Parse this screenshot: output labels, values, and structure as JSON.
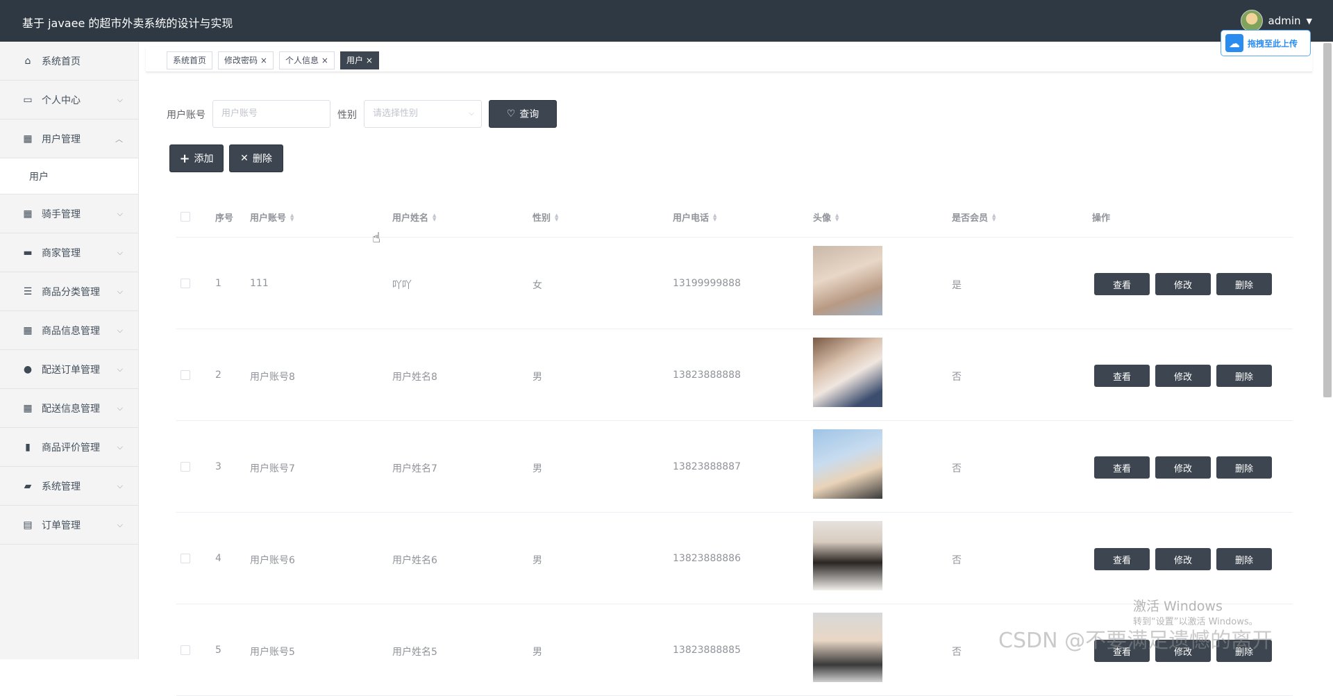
{
  "header": {
    "title": "基于 javaee 的超市外卖系统的设计与实现",
    "user_name": "admin",
    "user_caret": "▼"
  },
  "upload": {
    "label": "拖拽至此上传"
  },
  "sidebar": {
    "items": [
      {
        "label": "系统首页",
        "icon": "home-icon",
        "arrow": ""
      },
      {
        "label": "个人中心",
        "icon": "card-icon",
        "arrow": "⌵"
      },
      {
        "label": "用户管理",
        "icon": "grid-icon",
        "arrow": "︿"
      },
      {
        "label": "骑手管理",
        "icon": "grid-icon",
        "arrow": "⌵"
      },
      {
        "label": "商家管理",
        "icon": "briefcase-icon",
        "arrow": "⌵"
      },
      {
        "label": "商品分类管理",
        "icon": "list-icon",
        "arrow": "⌵"
      },
      {
        "label": "商品信息管理",
        "icon": "grid-icon",
        "arrow": "⌵"
      },
      {
        "label": "配送订单管理",
        "icon": "pin-icon",
        "arrow": "⌵"
      },
      {
        "label": "配送信息管理",
        "icon": "grid-icon",
        "arrow": "⌵"
      },
      {
        "label": "商品评价管理",
        "icon": "book-icon",
        "arrow": "⌵"
      },
      {
        "label": "系统管理",
        "icon": "ticket-icon",
        "arrow": "⌵"
      },
      {
        "label": "订单管理",
        "icon": "clipboard-icon",
        "arrow": "⌵"
      }
    ],
    "sub_item": "用户"
  },
  "tags": [
    {
      "label": "系统首页"
    },
    {
      "label": "修改密码 ×"
    },
    {
      "label": "个人信息 ×"
    },
    {
      "label": "用户 ×"
    }
  ],
  "search": {
    "account_label": "用户账号",
    "account_placeholder": "用户账号",
    "gender_label": "性别",
    "gender_placeholder": "请选择性别",
    "query_label": "查询"
  },
  "actions": {
    "add_label": "添加",
    "delete_label": "删除"
  },
  "table": {
    "columns": [
      "序号",
      "用户账号",
      "用户姓名",
      "性别",
      "用户电话",
      "头像",
      "是否会员",
      "操作"
    ],
    "rows": [
      {
        "no": "1",
        "account": "111",
        "name": "吖吖",
        "gender": "女",
        "phone": "13199999888",
        "member": "是"
      },
      {
        "no": "2",
        "account": "用户账号8",
        "name": "用户姓名8",
        "gender": "男",
        "phone": "13823888888",
        "member": "否"
      },
      {
        "no": "3",
        "account": "用户账号7",
        "name": "用户姓名7",
        "gender": "男",
        "phone": "13823888887",
        "member": "否"
      },
      {
        "no": "4",
        "account": "用户账号6",
        "name": "用户姓名6",
        "gender": "男",
        "phone": "13823888886",
        "member": "否"
      },
      {
        "no": "5",
        "account": "用户账号5",
        "name": "用户姓名5",
        "gender": "男",
        "phone": "13823888885",
        "member": "否"
      }
    ],
    "view_label": "查看",
    "edit_label": "修改",
    "delete_label": "删除"
  },
  "watermark": {
    "activate_title": "激活 Windows",
    "activate_sub": "转到“设置”以激活 Windows。",
    "csdn": "CSDN @不要满足遗憾的离开"
  }
}
